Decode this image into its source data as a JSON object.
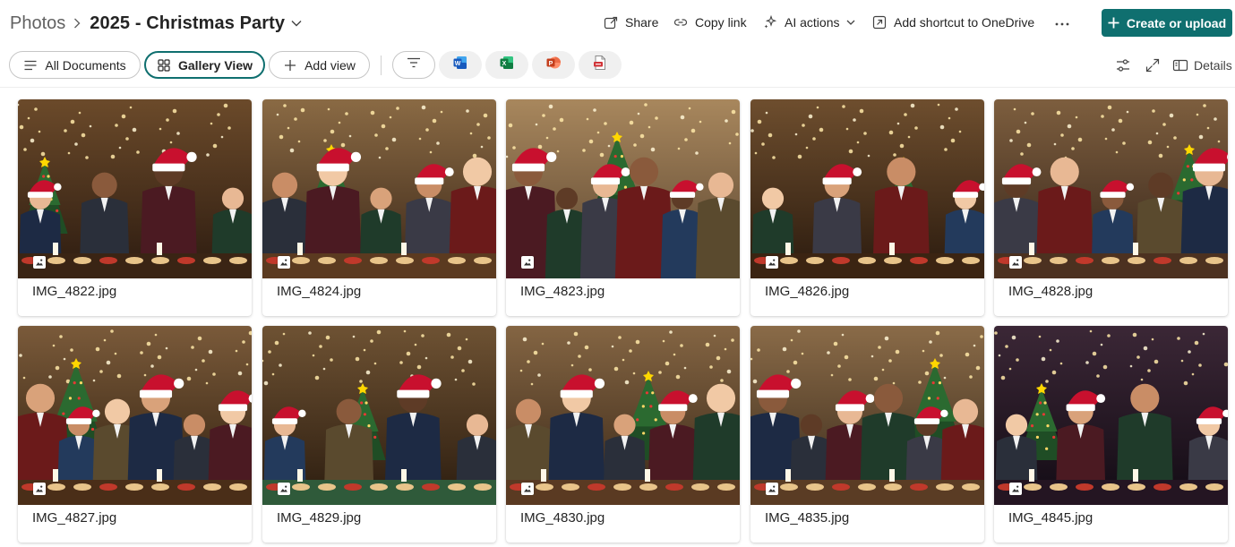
{
  "breadcrumb": {
    "parent": "Photos",
    "current": "2025 - Christmas Party"
  },
  "command_bar": {
    "share": "Share",
    "copy_link": "Copy link",
    "ai_actions": "AI actions",
    "add_shortcut": "Add shortcut to OneDrive",
    "create_upload": "Create or upload"
  },
  "views": {
    "all_documents": "All Documents",
    "gallery_view": "Gallery View",
    "add_view": "Add view",
    "active": "Gallery View"
  },
  "app_icons": [
    "word-icon",
    "excel-icon",
    "powerpoint-icon",
    "pdf-icon"
  ],
  "right_tools": {
    "details": "Details"
  },
  "colors": {
    "accent": "#0f6f6f",
    "word": "#185abd",
    "excel": "#107c41",
    "powerpoint": "#c43e1c",
    "pdf": "#d13438"
  },
  "photos": [
    {
      "name": "IMG_4822.jpg",
      "scene": "selfie"
    },
    {
      "name": "IMG_4824.jpg",
      "scene": "buffet"
    },
    {
      "name": "IMG_4823.jpg",
      "scene": "sack-race"
    },
    {
      "name": "IMG_4826.jpg",
      "scene": "gifts"
    },
    {
      "name": "IMG_4828.jpg",
      "scene": "selfie-tree"
    },
    {
      "name": "IMG_4827.jpg",
      "scene": "toast"
    },
    {
      "name": "IMG_4829.jpg",
      "scene": "foosball"
    },
    {
      "name": "IMG_4830.jpg",
      "scene": "target-game"
    },
    {
      "name": "IMG_4835.jpg",
      "scene": "limbo"
    },
    {
      "name": "IMG_4845.jpg",
      "scene": "dance-floor"
    }
  ]
}
